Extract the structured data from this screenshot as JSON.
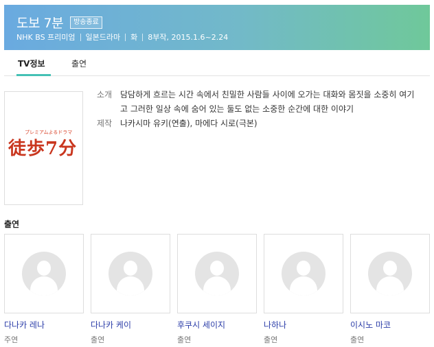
{
  "header": {
    "title": "도보 7분",
    "status_badge": "방송종료",
    "meta": [
      "NHK BS 프리미엄",
      "일본드라마",
      "화",
      "8부작, 2015.1.6~2.24"
    ]
  },
  "tabs": [
    {
      "label": "TV정보",
      "active": true
    },
    {
      "label": "출연",
      "active": false
    }
  ],
  "poster": {
    "small_text": "プレミアムよるドラマ",
    "main_text": "徒歩7分"
  },
  "info": {
    "synopsis_label": "소개",
    "synopsis": "담담하게 흐르는 시간 속에서 친밀한 사람들 사이에 오가는 대화와 몸짓을 소중히 여기고 그러한 일상 속에 숨어 있는 둘도 없는 소중한 순간에 대한 이야기",
    "production_label": "제작",
    "production": "나카시마 유키(연출), 마에다 시로(극본)"
  },
  "cast": {
    "heading": "출연",
    "members": [
      {
        "name": "다나카 레나",
        "role": "주연"
      },
      {
        "name": "다나카 케이",
        "role": "출연"
      },
      {
        "name": "후쿠시 세이지",
        "role": "출연"
      },
      {
        "name": "나하나",
        "role": "출연"
      },
      {
        "name": "이시노 마코",
        "role": "출연"
      }
    ]
  },
  "colors": {
    "header_gradient_start": "#6aaae0",
    "header_gradient_end": "#6fc89a",
    "tab_accent": "#44c1b5",
    "cast_name": "#2b3da8",
    "poster_title": "#c9361e"
  },
  "icons": {
    "cast_placeholder": "person-silhouette-icon"
  }
}
